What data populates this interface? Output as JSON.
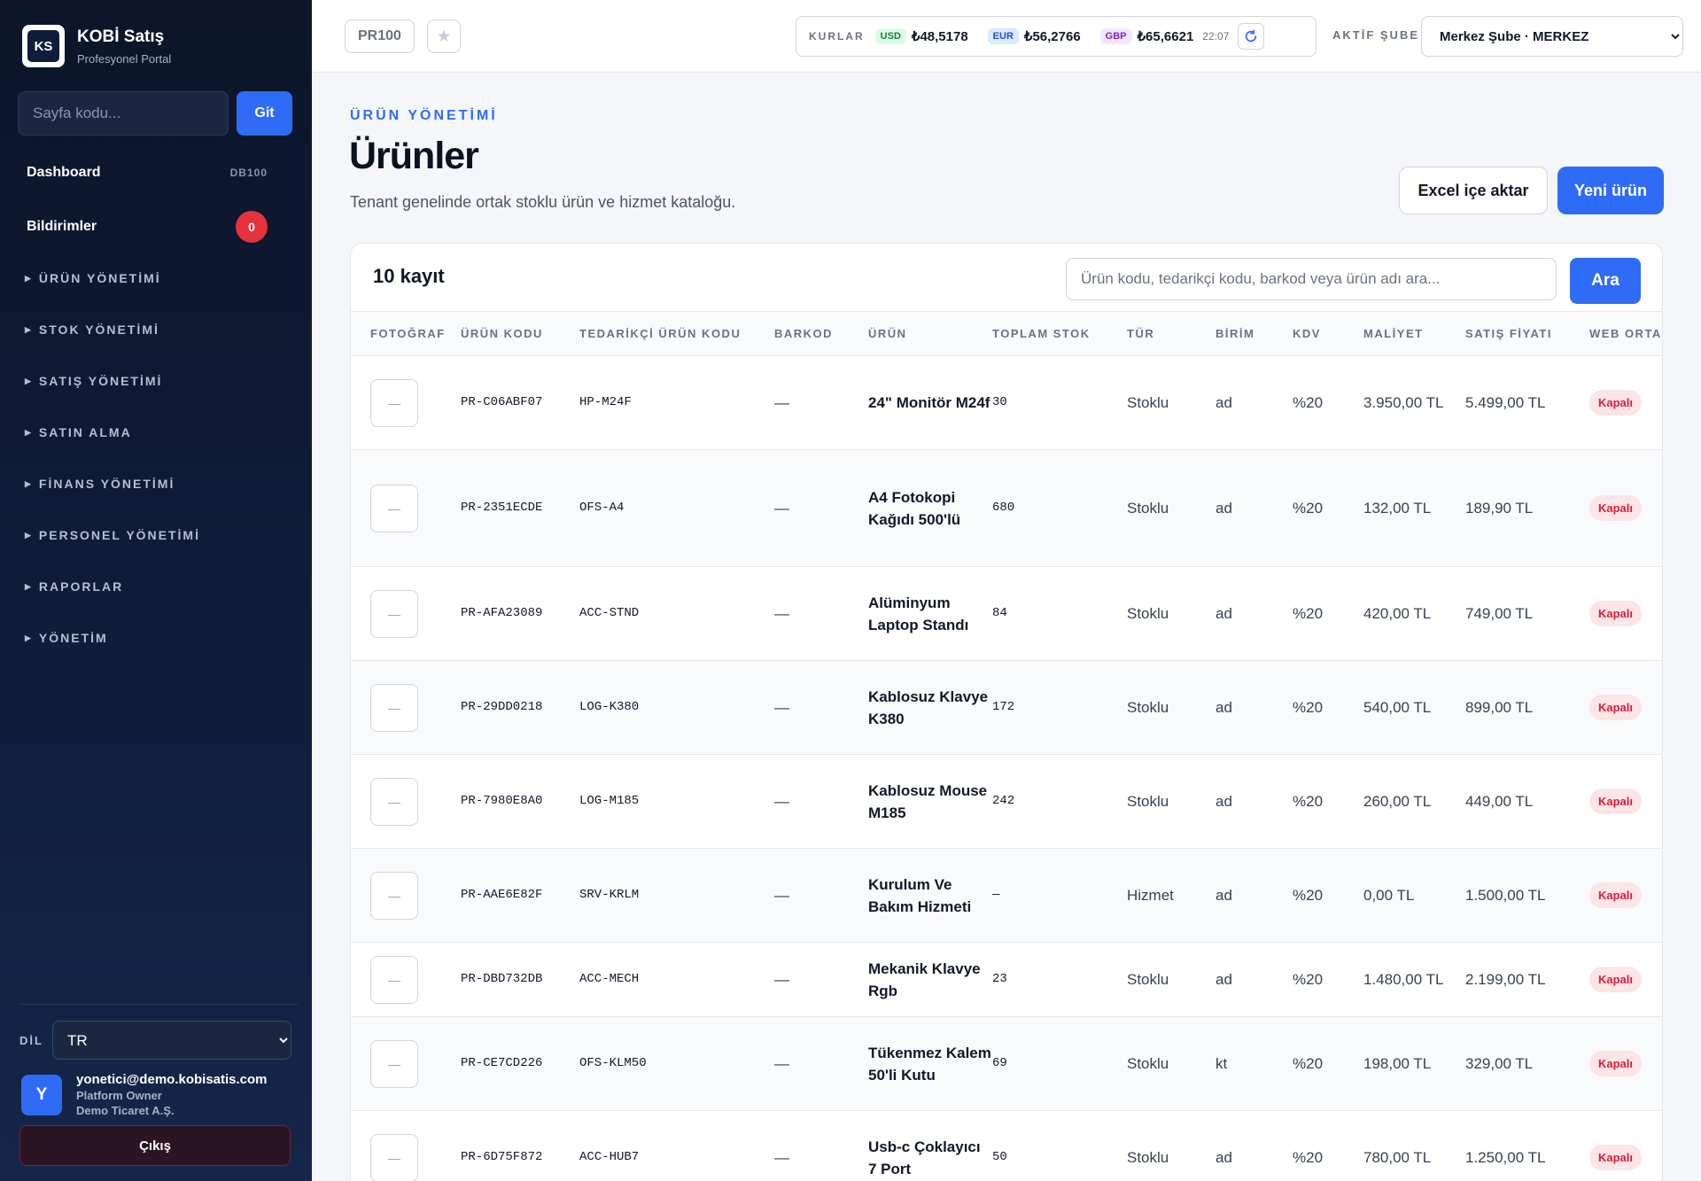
{
  "brand": {
    "logo_text": "KS",
    "title": "KOBİ Satış",
    "subtitle": "Profesyonel Portal"
  },
  "page_search": {
    "placeholder": "Sayfa kodu...",
    "button": "Git"
  },
  "nav": {
    "dashboard": {
      "label": "Dashboard",
      "code": "DB100"
    },
    "notifications": {
      "label": "Bildirimler",
      "count": "0"
    },
    "sections": [
      "ÜRÜN YÖNETİMİ",
      "STOK YÖNETİMİ",
      "SATIŞ YÖNETİMİ",
      "SATIN ALMA",
      "FİNANS YÖNETİMİ",
      "PERSONEL YÖNETİMİ",
      "RAPORLAR",
      "YÖNETİM"
    ]
  },
  "language": {
    "label": "DİL",
    "selected": "TR"
  },
  "user": {
    "initial": "Y",
    "email": "yonetici@demo.kobisatis.com",
    "role": "Platform Owner",
    "company": "Demo Ticaret A.Ş."
  },
  "logout_label": "Çıkış",
  "topbar": {
    "page_code": "PR100",
    "rates_label": "KURLAR",
    "rates": [
      {
        "code": "USD",
        "value": "₺48,5178",
        "bg": "#dcfce7",
        "fg": "#15803d"
      },
      {
        "code": "EUR",
        "value": "₺56,2766",
        "bg": "#dbeafe",
        "fg": "#1d4ed8"
      },
      {
        "code": "GBP",
        "value": "₺65,6621",
        "bg": "#f3e8ff",
        "fg": "#7e22ce"
      }
    ],
    "rates_time": "22:07",
    "branch_label": "AKTİF ŞUBE",
    "branch_selected": "Merkez Şube · MERKEZ"
  },
  "header": {
    "eyebrow": "ÜRÜN YÖNETİMİ",
    "title": "Ürünler",
    "description": "Tenant genelinde ortak stoklu ürün ve hizmet kataloğu.",
    "import_button": "Excel içe aktar",
    "new_button": "Yeni ürün"
  },
  "table": {
    "record_count": "10 kayıt",
    "search_placeholder": "Ürün kodu, tedarikçi kodu, barkod veya ürün adı ara...",
    "search_button": "Ara",
    "columns": [
      "FOTOĞRAF",
      "ÜRÜN KODU",
      "TEDARİKÇİ ÜRÜN KODU",
      "BARKOD",
      "ÜRÜN",
      "TOPLAM STOK",
      "TÜR",
      "BİRİM",
      "KDV",
      "MALİYET",
      "SATIŞ FİYATI",
      "WEB ORTAMI"
    ],
    "photo_placeholder": "—",
    "rows": [
      {
        "code": "PR-C06ABF07",
        "supplier_code": "HP-M24F",
        "barcode": "—",
        "name": "24\" Monitör M24f",
        "stock": "30",
        "type": "Stoklu",
        "unit": "ad",
        "vat": "%20",
        "cost": "3.950,00 TL",
        "price": "5.499,00 TL",
        "web": "Kapalı"
      },
      {
        "code": "PR-2351ECDE",
        "supplier_code": "OFS-A4",
        "barcode": "—",
        "name": "A4 Fotokopi Kağıdı 500'lü",
        "stock": "680",
        "type": "Stoklu",
        "unit": "ad",
        "vat": "%20",
        "cost": "132,00 TL",
        "price": "189,90 TL",
        "web": "Kapalı"
      },
      {
        "code": "PR-AFA23089",
        "supplier_code": "ACC-STND",
        "barcode": "—",
        "name": "Alüminyum Laptop Standı",
        "stock": "84",
        "type": "Stoklu",
        "unit": "ad",
        "vat": "%20",
        "cost": "420,00 TL",
        "price": "749,00 TL",
        "web": "Kapalı"
      },
      {
        "code": "PR-29DD0218",
        "supplier_code": "LOG-K380",
        "barcode": "—",
        "name": "Kablosuz Klavye K380",
        "stock": "172",
        "type": "Stoklu",
        "unit": "ad",
        "vat": "%20",
        "cost": "540,00 TL",
        "price": "899,00 TL",
        "web": "Kapalı"
      },
      {
        "code": "PR-7980E8A0",
        "supplier_code": "LOG-M185",
        "barcode": "—",
        "name": "Kablosuz Mouse M185",
        "stock": "242",
        "type": "Stoklu",
        "unit": "ad",
        "vat": "%20",
        "cost": "260,00 TL",
        "price": "449,00 TL",
        "web": "Kapalı"
      },
      {
        "code": "PR-AAE6E82F",
        "supplier_code": "SRV-KRLM",
        "barcode": "—",
        "name": "Kurulum Ve Bakım Hizmeti",
        "stock": "—",
        "type": "Hizmet",
        "unit": "ad",
        "vat": "%20",
        "cost": "0,00 TL",
        "price": "1.500,00 TL",
        "web": "Kapalı"
      },
      {
        "code": "PR-DBD732DB",
        "supplier_code": "ACC-MECH",
        "barcode": "—",
        "name": "Mekanik Klavye Rgb",
        "stock": "23",
        "type": "Stoklu",
        "unit": "ad",
        "vat": "%20",
        "cost": "1.480,00 TL",
        "price": "2.199,00 TL",
        "web": "Kapalı"
      },
      {
        "code": "PR-CE7CD226",
        "supplier_code": "OFS-KLM50",
        "barcode": "—",
        "name": "Tükenmez Kalem 50'li Kutu",
        "stock": "69",
        "type": "Stoklu",
        "unit": "kt",
        "vat": "%20",
        "cost": "198,00 TL",
        "price": "329,00 TL",
        "web": "Kapalı"
      },
      {
        "code": "PR-6D75F872",
        "supplier_code": "ACC-HUB7",
        "barcode": "—",
        "name": "Usb-c Çoklayıcı 7 Port",
        "stock": "50",
        "type": "Stoklu",
        "unit": "ad",
        "vat": "%20",
        "cost": "780,00 TL",
        "price": "1.250,00 TL",
        "web": "Kapalı"
      }
    ]
  }
}
